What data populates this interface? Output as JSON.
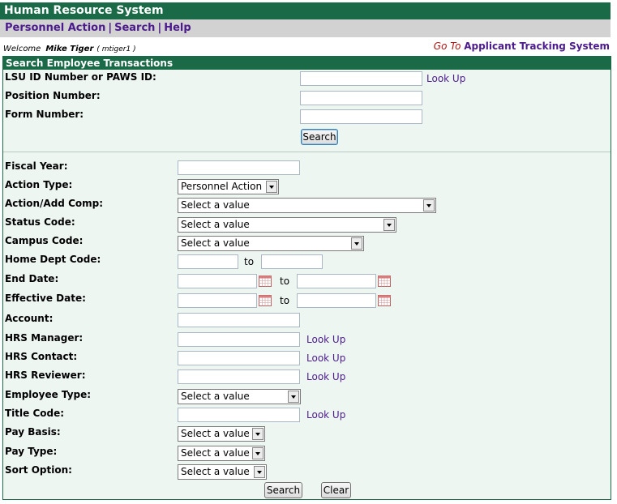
{
  "app": {
    "title": "Human Resource System"
  },
  "nav": {
    "items": [
      "Personnel Action",
      "Search",
      "Help"
    ],
    "separator": "|"
  },
  "welcome": {
    "label": "Welcome",
    "user": "Mike Tiger",
    "userid": "( mtiger1 )"
  },
  "goto": {
    "label": "Go To",
    "link": "Applicant Tracking System"
  },
  "search_panel": {
    "title": "Search Employee Transactions",
    "lsu_id_label": "LSU ID Number or PAWS ID:",
    "position_label": "Position Number:",
    "form_label": "Form Number:",
    "lookup": "Look Up",
    "search_button": "Search"
  },
  "filters": {
    "fiscal_year": "Fiscal Year:",
    "action_type": "Action Type:",
    "action_type_value": "Personnel Action",
    "action_add_comp": "Action/Add Comp:",
    "status_code": "Status Code:",
    "campus_code": "Campus Code:",
    "home_dept_code": "Home Dept Code:",
    "end_date": "End Date:",
    "effective_date": "Effective Date:",
    "account": "Account:",
    "hrs_manager": "HRS Manager:",
    "hrs_contact": "HRS Contact:",
    "hrs_reviewer": "HRS Reviewer:",
    "employee_type": "Employee Type:",
    "title_code": "Title Code:",
    "pay_basis": "Pay Basis:",
    "pay_type": "Pay Type:",
    "sort_option": "Sort Option:",
    "select_placeholder": "Select a value",
    "to": "to",
    "lookup": "Look Up",
    "search_button": "Search",
    "clear_button": "Clear"
  },
  "colors": {
    "header_green": "#1b6a47",
    "link_purple": "#4b1a8c",
    "goto_red": "#b01010"
  },
  "icons": {
    "calendar": "calendar-icon",
    "dropdown": "chevron-down-icon"
  }
}
